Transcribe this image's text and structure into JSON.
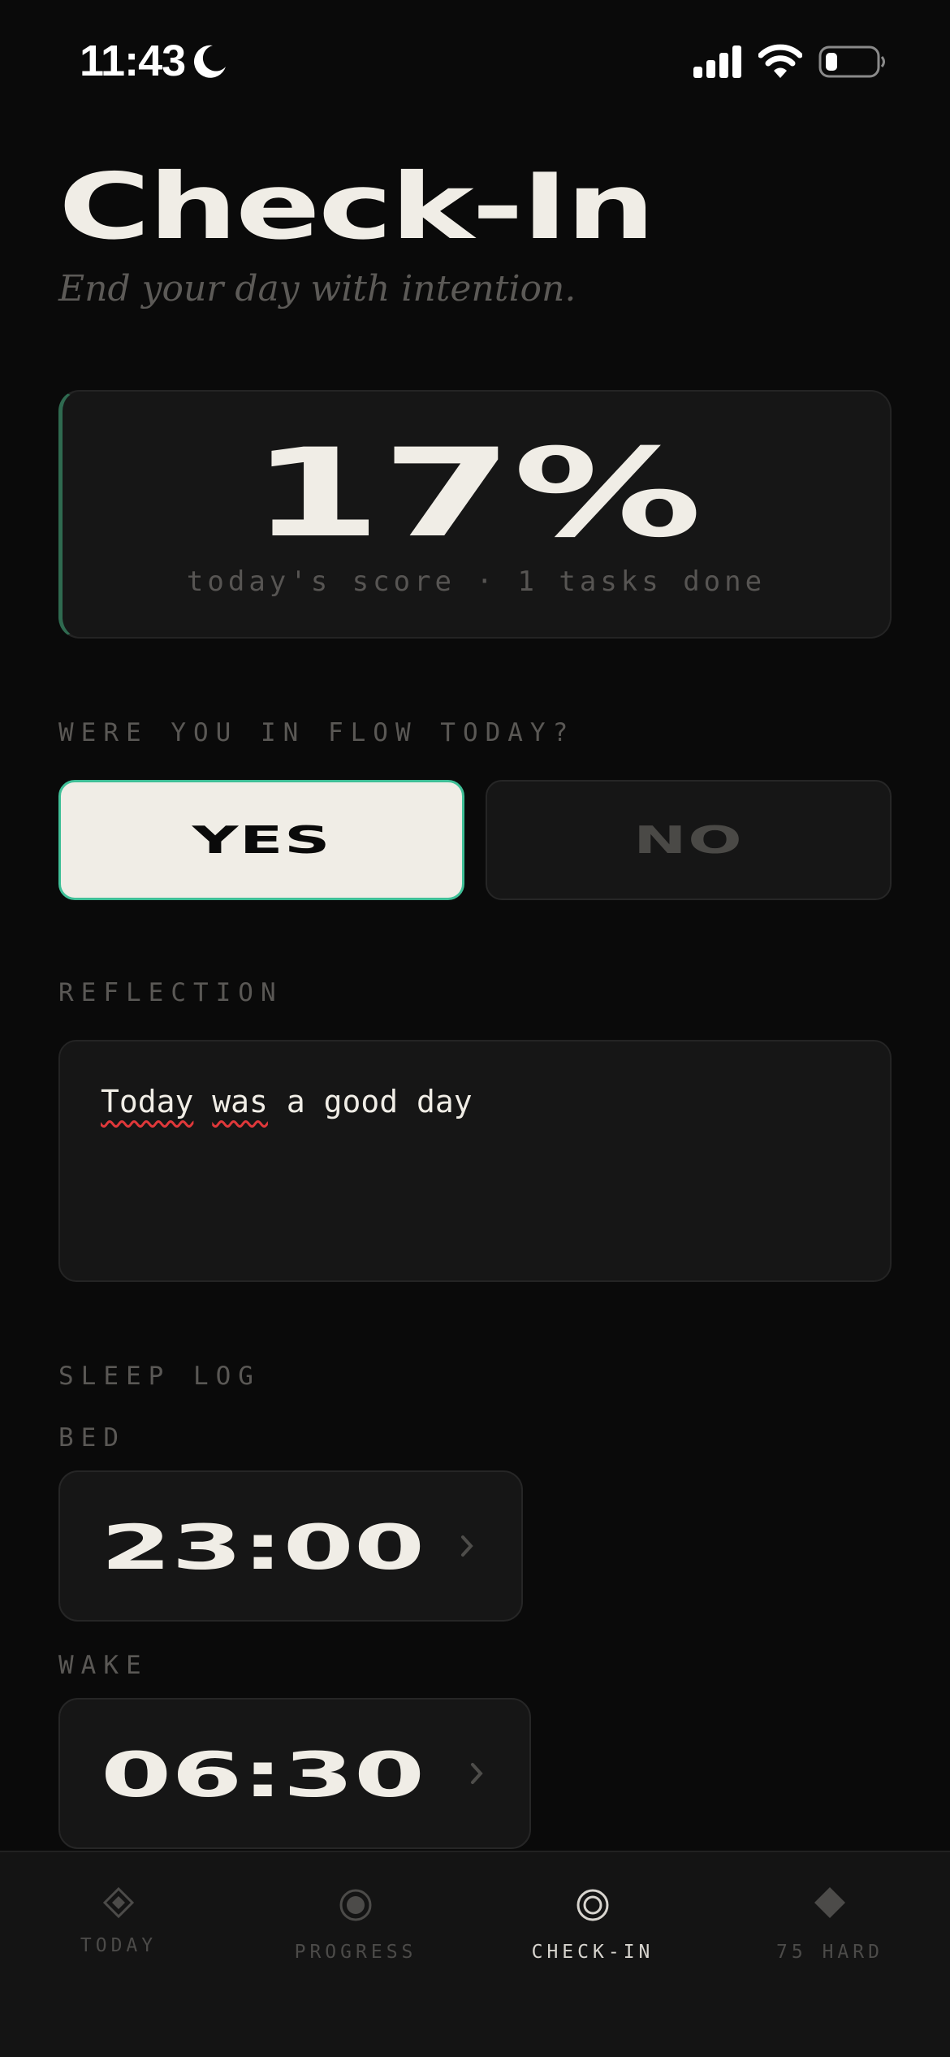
{
  "status_bar": {
    "time": "11:43",
    "icons": [
      "moon-icon",
      "signal-icon",
      "wifi-icon",
      "battery-icon"
    ]
  },
  "header": {
    "title": "Check-In",
    "subtitle": "End your day with intention."
  },
  "score_card": {
    "score": "17%",
    "caption": "today's score · 1 tasks done",
    "accent_color": "#2f6a50"
  },
  "flow": {
    "question": "WERE YOU IN FLOW TODAY?",
    "options": [
      "YES",
      "NO"
    ],
    "selected": "YES",
    "selected_border_color": "#3fbf97"
  },
  "reflection": {
    "label": "REFLECTION",
    "value_words": [
      "Today",
      "was",
      "a good day"
    ],
    "misspelled": [
      "Today",
      "was"
    ]
  },
  "sleep_log": {
    "label": "SLEEP LOG",
    "bed_label": "BED",
    "bed_time": "23:00",
    "wake_label": "WAKE",
    "wake_time": "06:30"
  },
  "tab_bar": {
    "tabs": [
      {
        "label": "TODAY",
        "icon": "diamond-outline-icon"
      },
      {
        "label": "PROGRESS",
        "icon": "radio-circle-icon"
      },
      {
        "label": "CHECK-IN",
        "icon": "target-circle-icon"
      },
      {
        "label": "75 HARD",
        "icon": "diamond-filled-icon"
      }
    ],
    "active": "CHECK-IN"
  },
  "colors": {
    "background": "#0a0a0a",
    "card": "#161616",
    "text_primary": "#f0ede6",
    "text_muted": "#5a5855"
  }
}
